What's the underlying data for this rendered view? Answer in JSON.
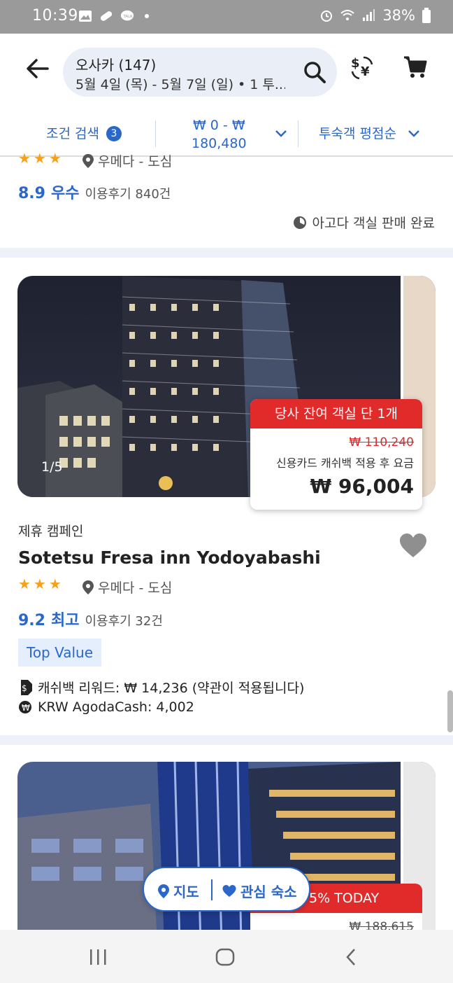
{
  "status_bar": {
    "time": "10:39",
    "battery": "38%"
  },
  "header": {
    "destination": "오사카 (147)",
    "dates_guests": "5월 4일 (목) - 5월 7일 (일) • 1 투..."
  },
  "filters": {
    "condition_label": "조건 검색",
    "condition_count": "3",
    "price_line1": "₩ 0 - ₩",
    "price_line2": "180,480",
    "sort_label": "투숙객 평점순"
  },
  "prev_card": {
    "location": "우메다 - 도심",
    "rating": "8.9",
    "rating_word": "우수",
    "reviews": "이용후기 840건",
    "sold_out": "아고다 객실 판매 완료"
  },
  "card": {
    "image_counter": "1/5",
    "banner": "당사 잔여 객실 단 1개",
    "original_price": "₩ 110,240",
    "price_note": "신용카드 캐쉬백 적용 후 요금",
    "final_price": "₩ 96,004",
    "campaign": "제휴 캠페인",
    "name": "Sotetsu Fresa inn Yodoyabashi",
    "star_count": 3,
    "location": "우메다 - 도심",
    "rating": "9.2",
    "rating_word": "최고",
    "reviews": "이용후기 32건",
    "tag": "Top Value",
    "cashback": "캐쉬백 리워드: ₩ 14,236 (약관이 적용됩니다)",
    "agodacash": "KRW AgodaCash: 4,002"
  },
  "next_card": {
    "banner": "5% TODAY",
    "original_price": "₩ 188,615"
  },
  "floating": {
    "map_label": "지도",
    "fav_label": "관심 숙소"
  },
  "colors": {
    "accent": "#2a67c9",
    "sale": "#e12b2b",
    "star": "#f7a11a"
  }
}
